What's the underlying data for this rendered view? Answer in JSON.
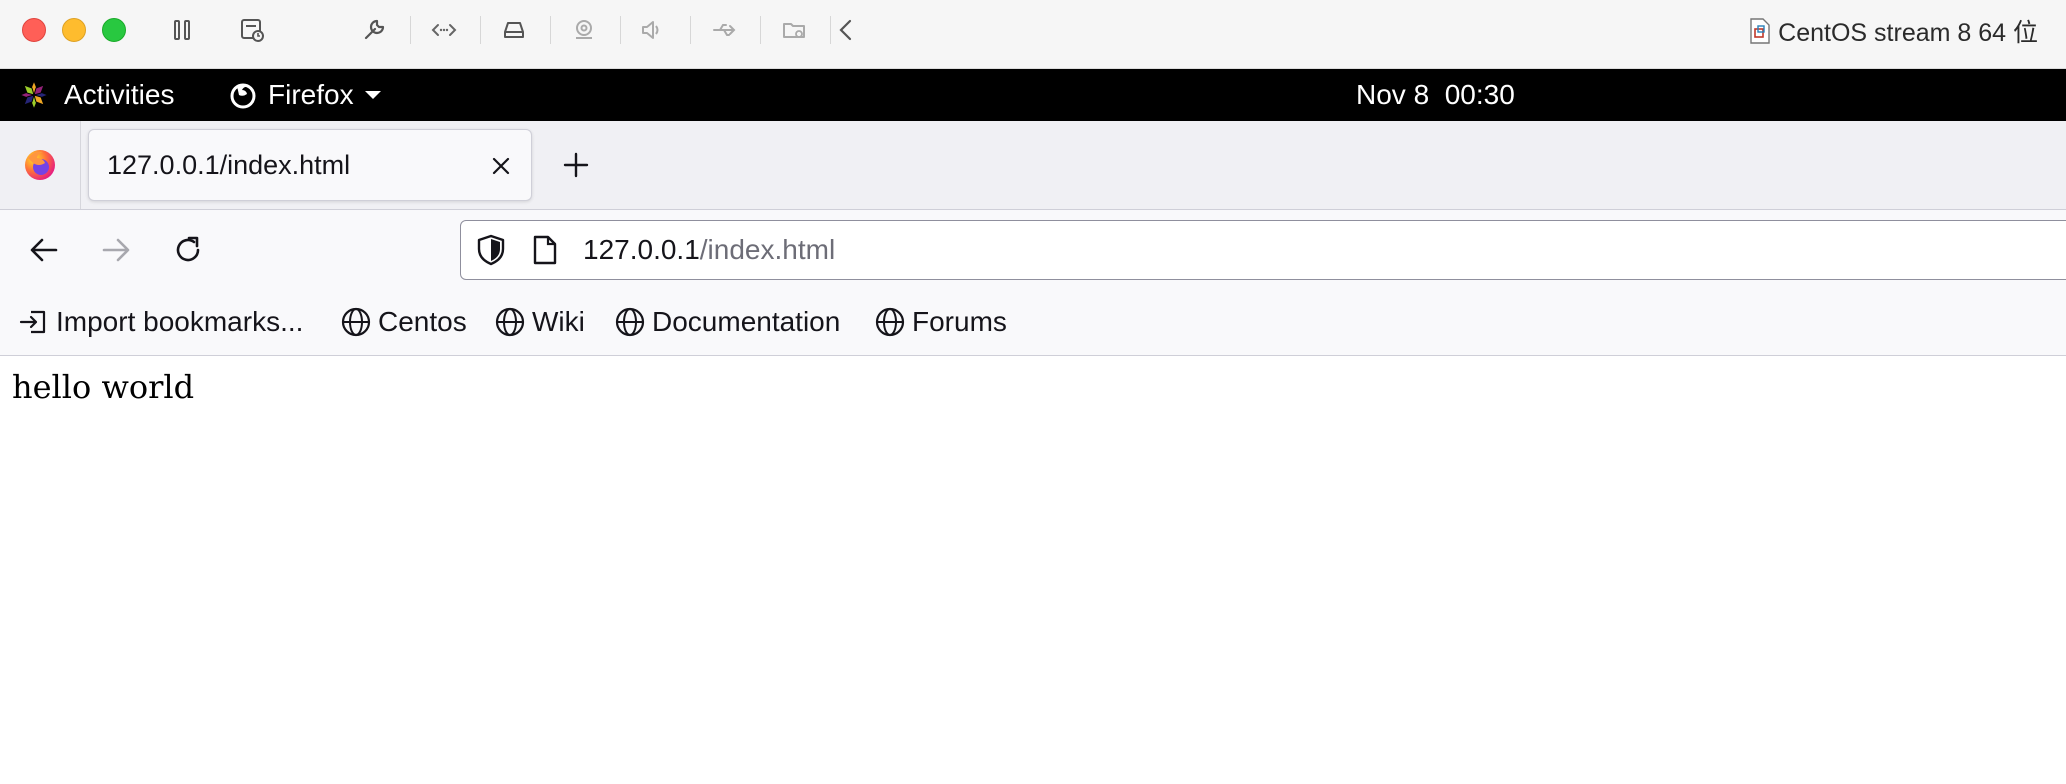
{
  "vm_window": {
    "title": "CentOS stream 8 64 位",
    "tool_icons": [
      "pause-icon",
      "snapshot-icon",
      "wrench-icon",
      "code-arrows-icon",
      "hard-disk-icon",
      "camera-icon",
      "speaker-icon",
      "usb-icon",
      "shared-folder-icon",
      "chevron-left-icon"
    ]
  },
  "gnome_topbar": {
    "activities_label": "Activities",
    "app_label": "Firefox",
    "clock": "Nov 8  00:30"
  },
  "browser": {
    "tabs": [
      {
        "title": "127.0.0.1/index.html",
        "active": true
      }
    ],
    "url": {
      "host": "127.0.0.1",
      "path": "/index.html"
    },
    "bookmarks": [
      {
        "label": "Import bookmarks...",
        "icon": "import-icon"
      },
      {
        "label": "Centos",
        "icon": "globe-icon"
      },
      {
        "label": "Wiki",
        "icon": "globe-icon"
      },
      {
        "label": "Documentation",
        "icon": "globe-icon"
      },
      {
        "label": "Forums",
        "icon": "globe-icon"
      }
    ]
  },
  "page": {
    "body_text": "hello world"
  },
  "colors": {
    "close": "#ff5f57",
    "minimize": "#febc2e",
    "maximize": "#28c840",
    "gnome_bar": "#000000"
  }
}
